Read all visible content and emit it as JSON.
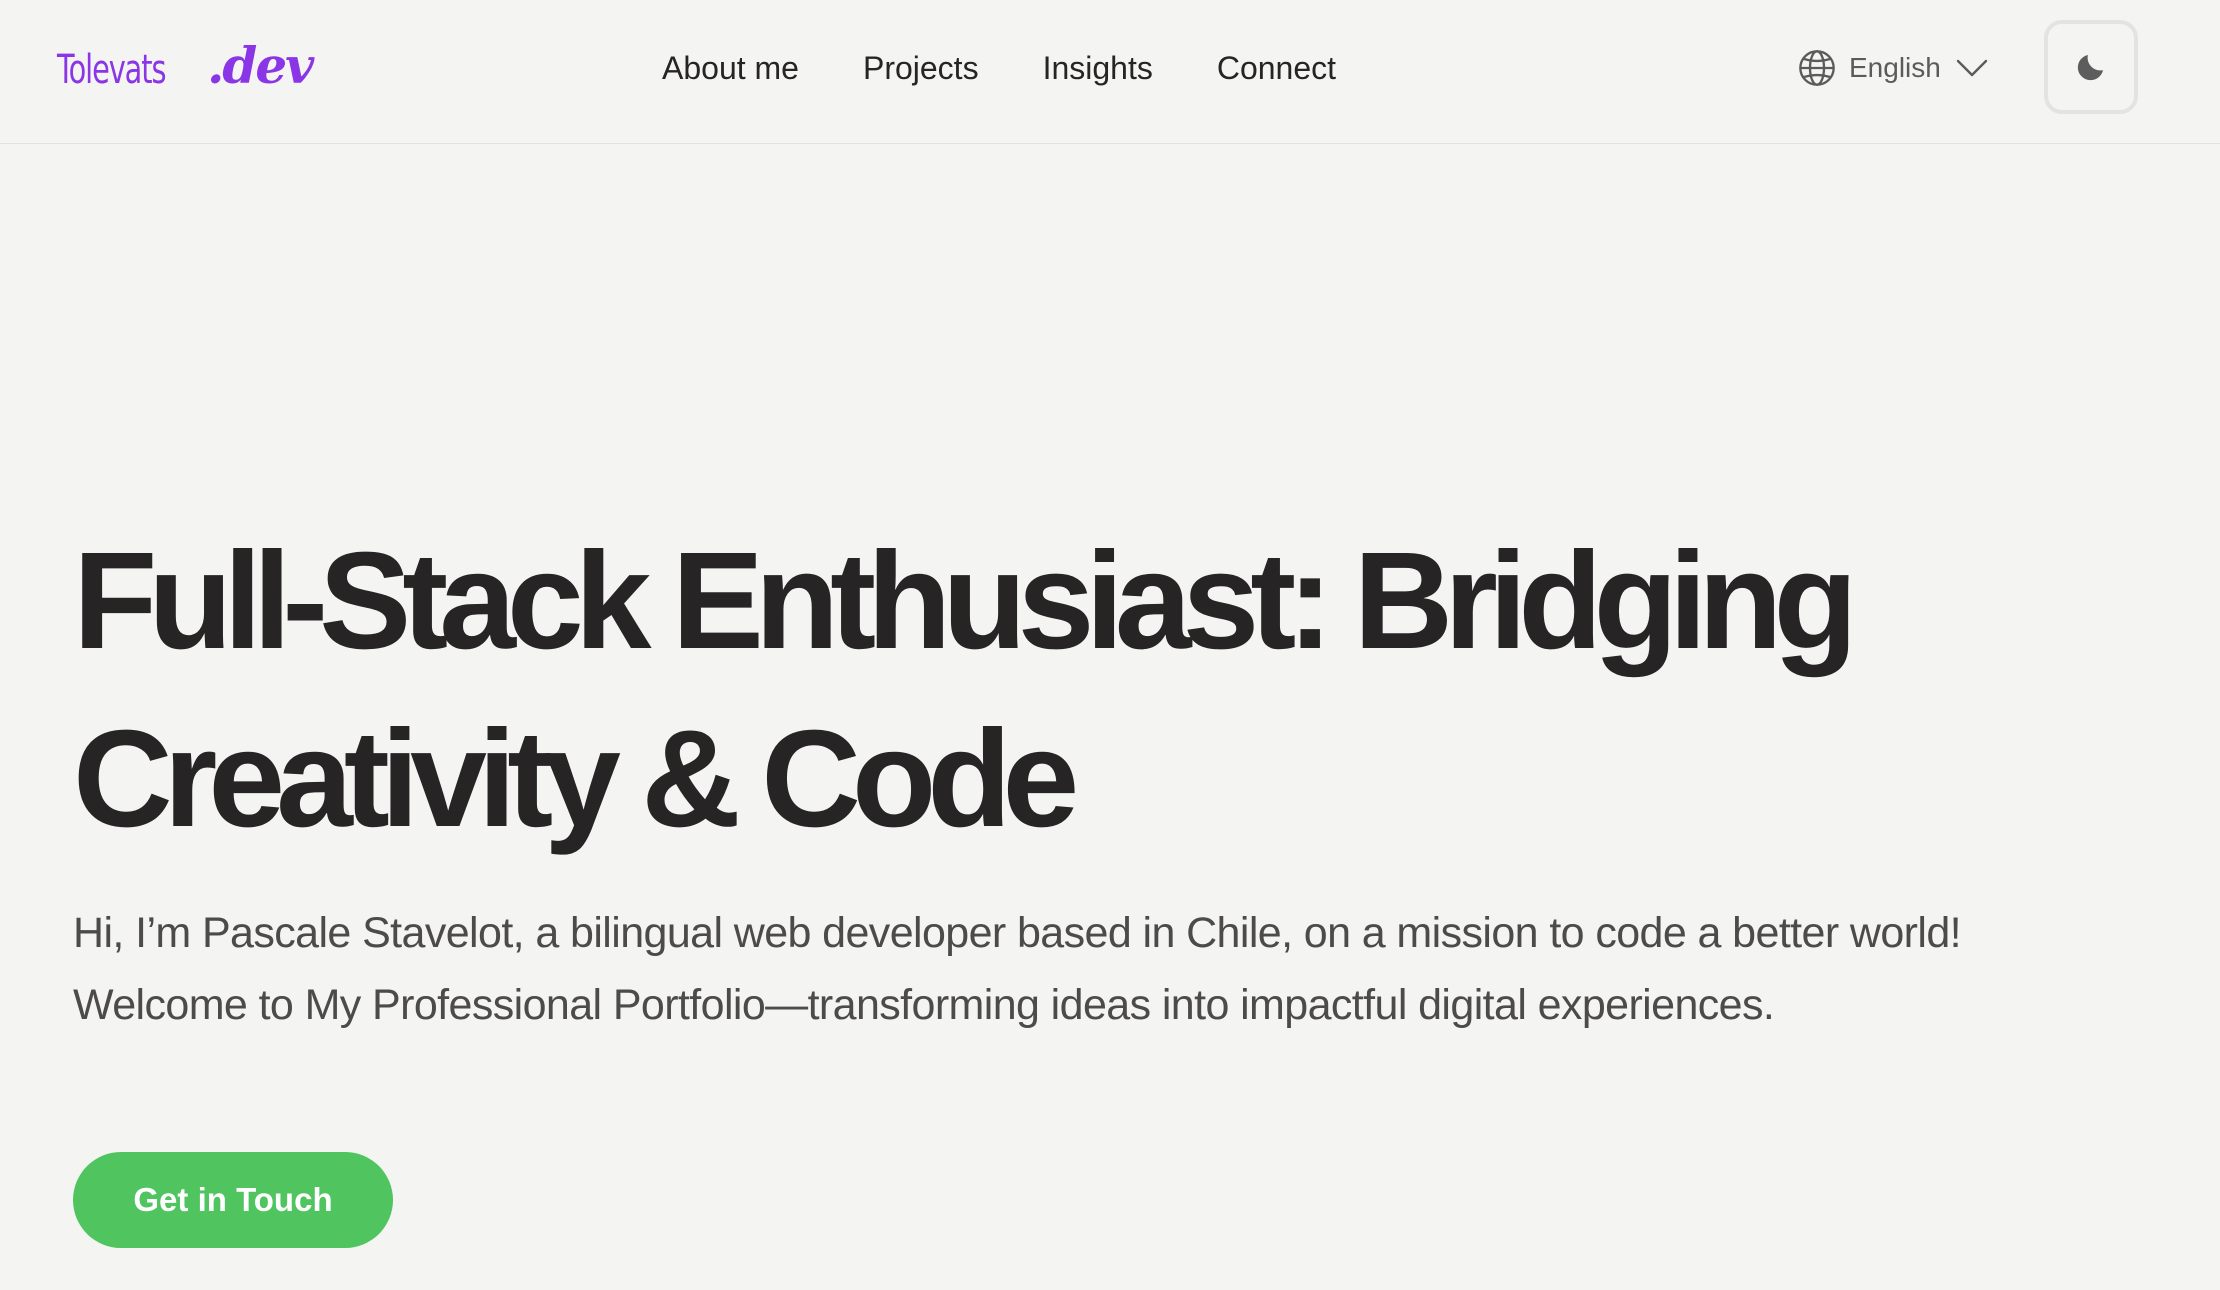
{
  "logo": {
    "name": "Tolevats",
    "tld": ".dev"
  },
  "nav": {
    "items": [
      {
        "label": "About me"
      },
      {
        "label": "Projects"
      },
      {
        "label": "Insights"
      },
      {
        "label": "Connect"
      }
    ]
  },
  "language": {
    "selected": "English",
    "icon": "globe-icon"
  },
  "theme_toggle": {
    "icon": "moon-icon"
  },
  "hero": {
    "title_line1": "Full-Stack Enthusiast: Bridging",
    "title_line2": "Creativity & Code",
    "subtitle_line1": "Hi, I’m Pascale Stavelot, a bilingual web developer based in Chile, on a mission to code a better world!",
    "subtitle_line2": "Welcome to My Professional Portfolio—transforming ideas into impactful digital experiences.",
    "cta_label": "Get in Touch"
  },
  "colors": {
    "background": "#f4f4f2",
    "brand_purple": "#8a35e6",
    "cta_green": "#4fc45f",
    "text_dark": "#262424",
    "text_muted": "#4d4b4a"
  }
}
